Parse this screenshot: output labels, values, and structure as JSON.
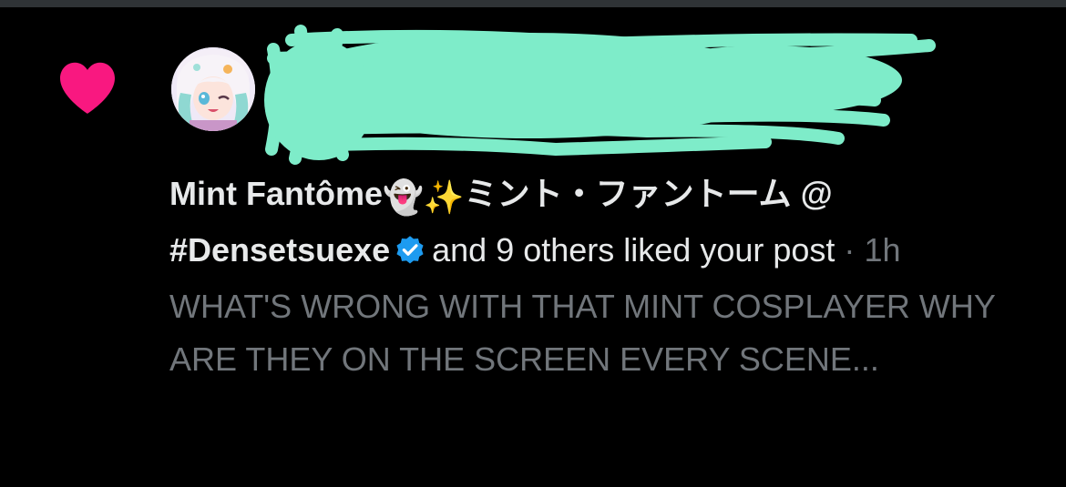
{
  "notification": {
    "user_name": "Mint Fantôme",
    "user_name_emojis": "👻✨",
    "user_name_jp": "ミント・ファントーム @",
    "user_name_tag": "#Densetsuexe",
    "verified": true,
    "action_text": "and 9 others liked your post",
    "separator": "·",
    "timestamp": "1h",
    "post_text": "WHAT'S WRONG WITH THAT MINT COSPLAYER WHY ARE THEY ON THE SCREEN EVERY SCENE..."
  },
  "icons": {
    "like": "heart-icon",
    "verified": "verified-badge-icon",
    "avatar": "user-avatar"
  },
  "colors": {
    "background": "#000000",
    "heart": "#f91880",
    "verified": "#1d9bf0",
    "primary_text": "#e7e9ea",
    "secondary_text": "#71767b",
    "redaction": "#7eecc9"
  }
}
